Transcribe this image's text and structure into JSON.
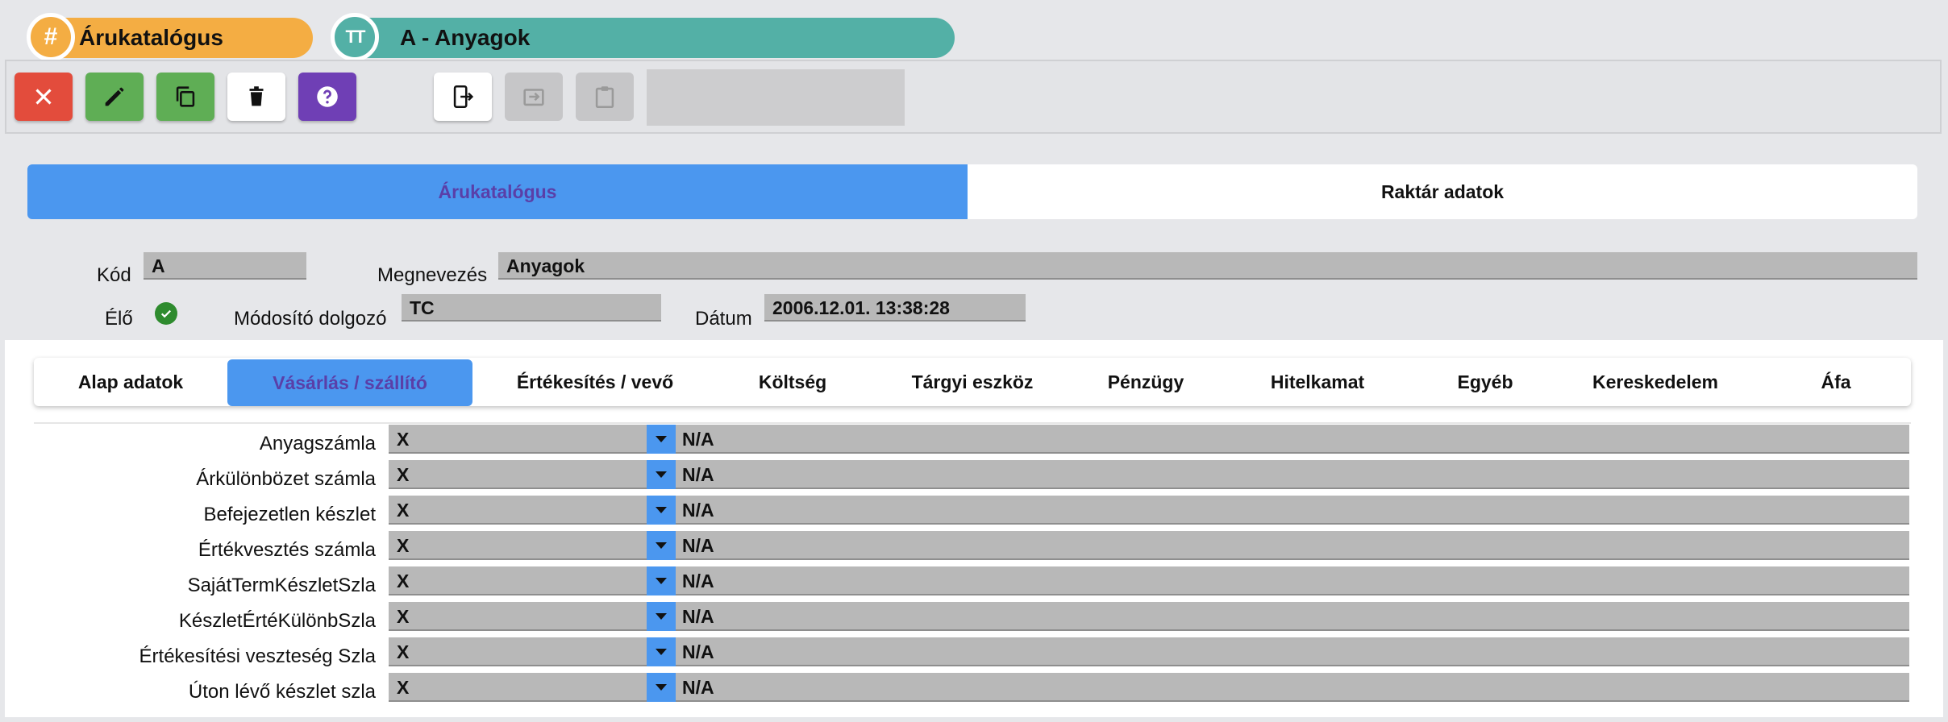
{
  "header": {
    "catalog_title": "Árukatalógus",
    "record_title": "A - Anyagok"
  },
  "toolbar": {
    "close": "close-icon",
    "edit": "pencil-icon",
    "copy": "copy-icon",
    "delete": "trash-icon",
    "help": "help-icon"
  },
  "main_tabs": [
    "Árukatalógus",
    "Raktár adatok"
  ],
  "form": {
    "code_label": "Kód",
    "code_value": "A",
    "name_label": "Megnevezés",
    "name_value": "Anyagok",
    "live_label": "Élő",
    "modifier_label": "Módosító dolgozó",
    "modifier_value": "TC",
    "date_label": "Dátum",
    "date_value": "2006.12.01. 13:38:28"
  },
  "sub_tabs": [
    "Alap adatok",
    "Vásárlás / szállító",
    "Értékesítés / vevő",
    "Költség",
    "Tárgyi eszköz",
    "Pénzügy",
    "Hitelkamat",
    "Egyéb",
    "Kereskedelem",
    "Áfa"
  ],
  "rows": [
    {
      "label": "Anyagszámla",
      "value": "X",
      "desc": "N/A"
    },
    {
      "label": "Árkülönbözet számla",
      "value": "X",
      "desc": "N/A"
    },
    {
      "label": "Befejezetlen készlet",
      "value": "X",
      "desc": "N/A"
    },
    {
      "label": "Értékvesztés számla",
      "value": "X",
      "desc": "N/A"
    },
    {
      "label": "SajátTermKészletSzla",
      "value": "X",
      "desc": "N/A"
    },
    {
      "label": "KészletÉrtéKülönbSzla",
      "value": "X",
      "desc": "N/A"
    },
    {
      "label": "Értékesítési veszteség Szla",
      "value": "X",
      "desc": "N/A"
    },
    {
      "label": "Úton lévő készlet szla",
      "value": "X",
      "desc": "N/A"
    }
  ]
}
